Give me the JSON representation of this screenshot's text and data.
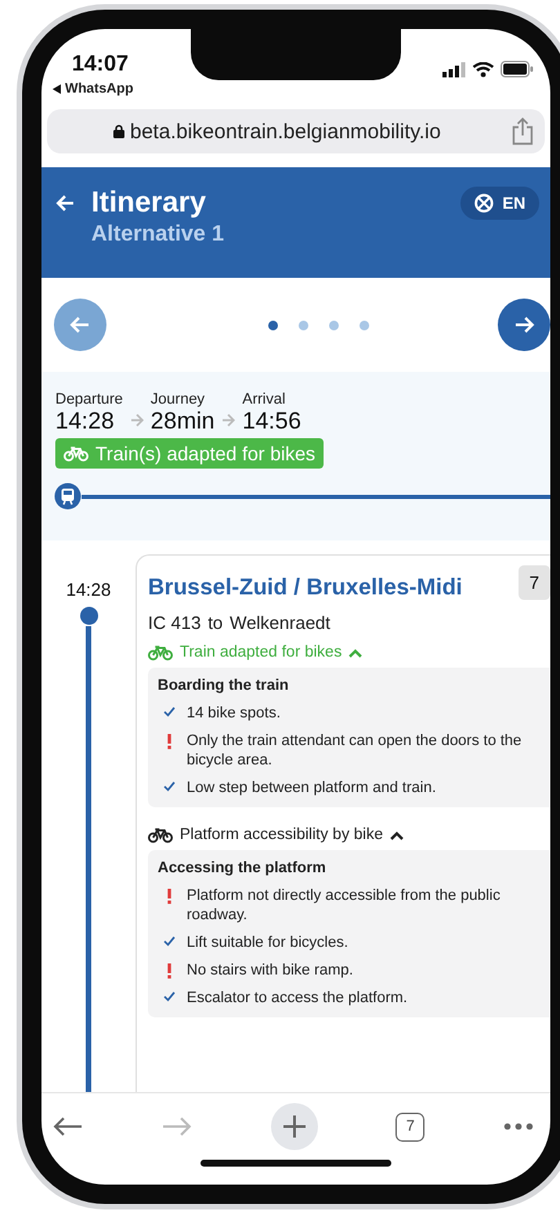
{
  "status_bar": {
    "time": "14:07",
    "back_app": "WhatsApp"
  },
  "address_bar": {
    "url": "beta.bikeontrain.belgianmobility.io"
  },
  "header": {
    "title": "Itinerary",
    "subtitle": "Alternative 1",
    "language": "EN"
  },
  "carousel": {
    "previous_disabled": true,
    "next_disabled": false,
    "dots": [
      {
        "selected": true
      },
      {
        "selected": false
      },
      {
        "selected": false
      },
      {
        "selected": false
      }
    ]
  },
  "summary": {
    "steps": [
      {
        "label": "Departure",
        "value": "14:28"
      },
      {
        "label": "Journey",
        "value": "28min"
      },
      {
        "label": "Arrival",
        "value": "14:56"
      }
    ],
    "badge": "Train(s) adapted for bikes"
  },
  "leg": {
    "time": "14:28",
    "station": "Brussel-Zuid / Bruxelles-Midi",
    "platform": "7",
    "train": "IC 413",
    "to": "to",
    "destination": "Welkenraedt",
    "sections": [
      {
        "kind": "adapted",
        "label": "Train adapted for bikes",
        "expanded": true,
        "box_title": "Boarding the train",
        "items": [
          {
            "kind": "ok",
            "text": "14 bike spots."
          },
          {
            "kind": "warning",
            "text": "Only the train attendant can open the doors to the bicycle area."
          },
          {
            "kind": "ok",
            "text": "Low step between platform and train."
          }
        ]
      },
      {
        "kind": "neutral",
        "label": "Platform accessibility by bike",
        "expanded": true,
        "box_title": "Accessing the platform",
        "items": [
          {
            "kind": "warning",
            "text": "Platform not directly accessible from the public roadway."
          },
          {
            "kind": "ok",
            "text": "Lift suitable for bicycles."
          },
          {
            "kind": "warning",
            "text": "No stairs with bike ramp."
          },
          {
            "kind": "ok",
            "text": "Escalator to access the platform."
          }
        ]
      }
    ]
  },
  "toolbar": {
    "tab_count": "7"
  }
}
